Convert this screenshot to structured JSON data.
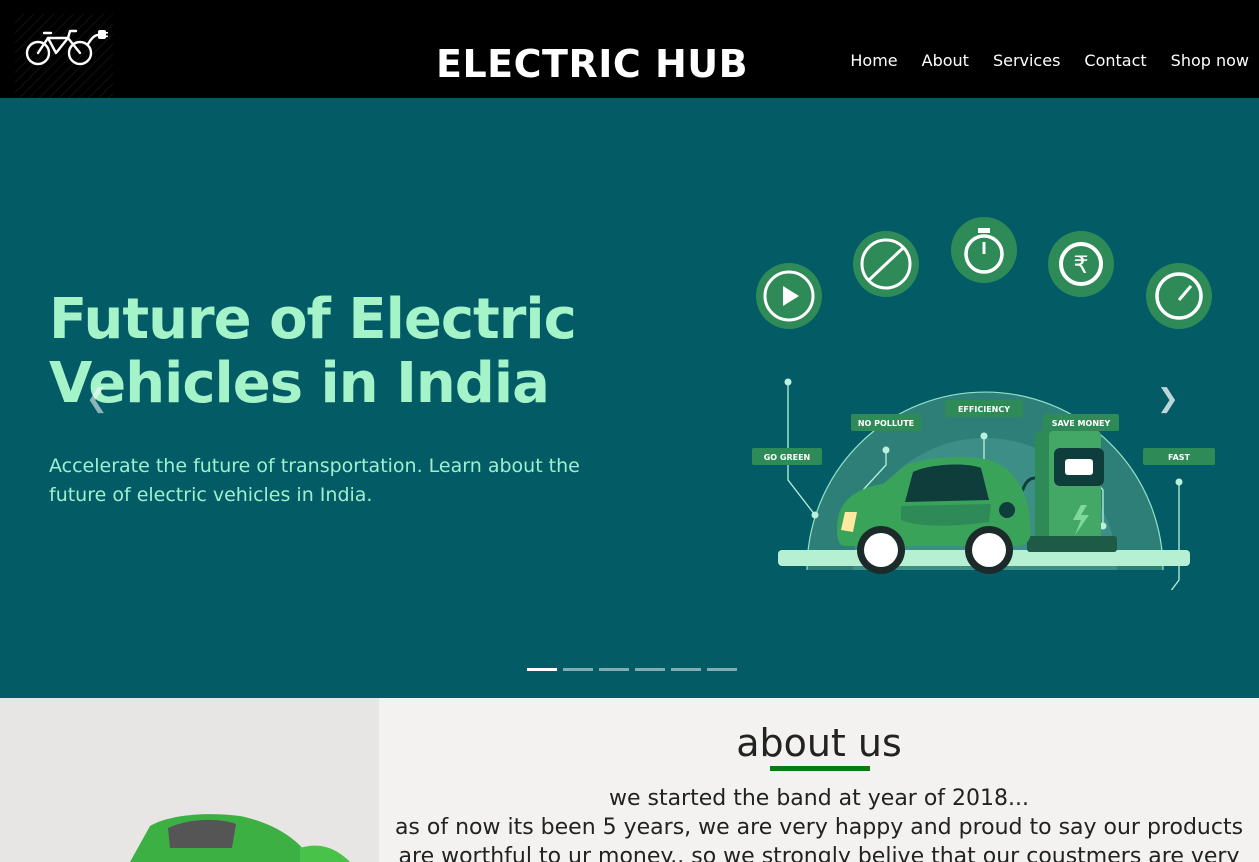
{
  "header": {
    "brand": "ELECTRIC HUB",
    "logo_icon": "electric-bicycle-plug-icon",
    "nav": [
      "Home",
      "About",
      "Services",
      "Contact",
      "Shop now"
    ]
  },
  "hero": {
    "title_line1": "Future of Electric",
    "title_line2": "Vehicles in India",
    "subtitle_line1": "Accelerate the future of transportation. Learn about the",
    "subtitle_line2": "future of electric vehicles in India.",
    "prev_icon": "chevron-left-icon",
    "next_icon": "chevron-right-icon",
    "slide_count": 6,
    "active_slide": 1,
    "features": [
      "GO GREEN",
      "NO POLLUTE",
      "EFFICIENCY",
      "SAVE MONEY",
      "FAST"
    ],
    "colors": {
      "background": "#025b65",
      "accent": "#a5f3c9",
      "badge": "#2e8b57"
    }
  },
  "about": {
    "title": "about us",
    "line1": "we started the band at year of 2018...",
    "line2": "as of now its been 5 years, we are very happy and proud to say our products",
    "line3": "are worthful to ur money.. so we strongly belive that our coustmers are very"
  }
}
